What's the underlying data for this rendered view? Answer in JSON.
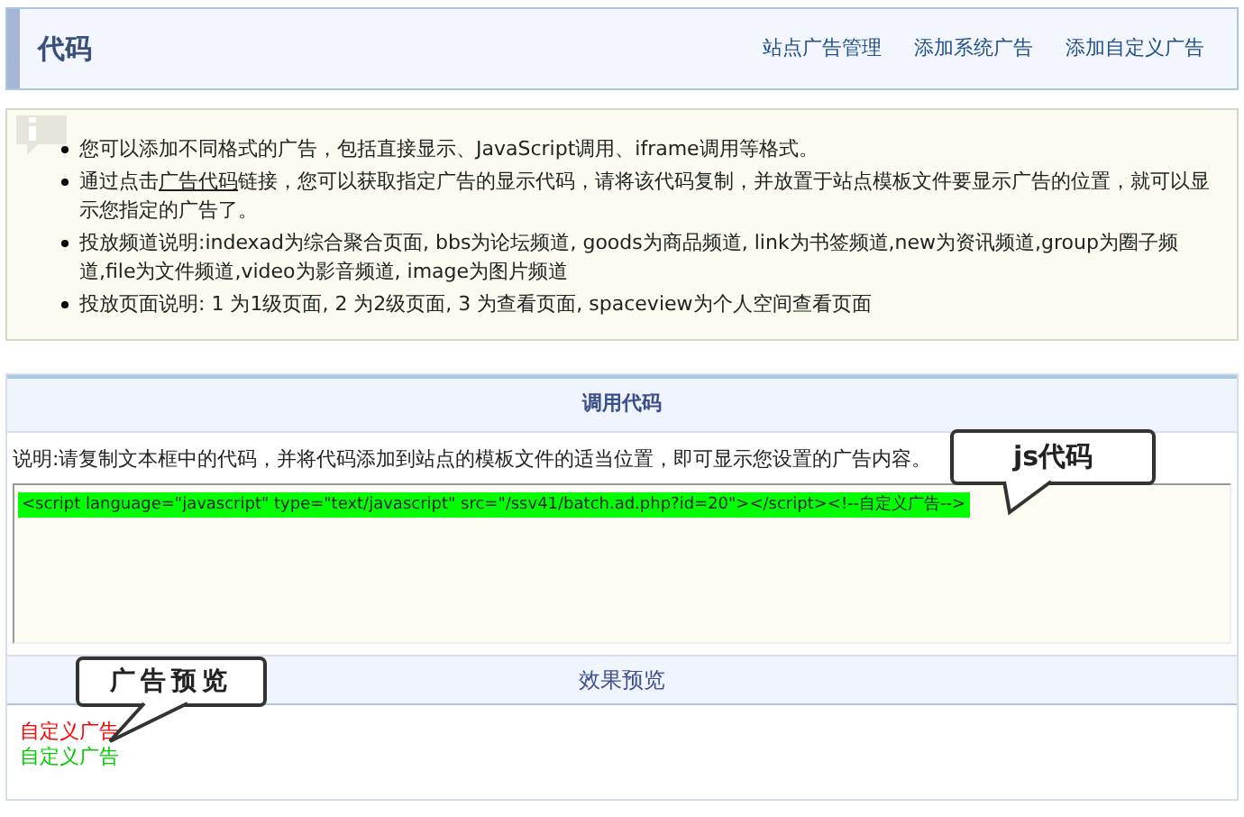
{
  "header": {
    "title": "代码",
    "links": [
      "站点广告管理",
      "添加系统广告",
      "添加自定义广告"
    ]
  },
  "tips": [
    {
      "text": "您可以添加不同格式的广告，包括直接显示、JavaScript调用、iframe调用等格式。"
    },
    {
      "before": "通过点击",
      "link": "广告代码",
      "after": "链接，您可以获取指定广告的显示代码，请将该代码复制，并放置于站点模板文件要显示广告的位置，就可以显示您指定的广告了。"
    },
    {
      "text": "投放频道说明:indexad为综合聚合页面, bbs为论坛频道, goods为商品频道, link为书签频道,new为资讯频道,group为圈子频道,file为文件频道,video为影音频道, image为图片频道"
    },
    {
      "text": "投放页面说明: 1 为1级页面, 2 为2级页面, 3 为查看页面, spaceview为个人空间查看页面"
    }
  ],
  "code_section": {
    "title": "调用代码",
    "description": "说明:请复制文本框中的代码，并将代码添加到站点的模板文件的适当位置，即可显示您设置的广告内容。",
    "code": "<script language=\"javascript\" type=\"text/javascript\" src=\"/ssv41/batch.ad.php?id=20\"></script><!--自定义广告-->"
  },
  "preview_section": {
    "title": "效果预览",
    "items": [
      {
        "text": "自定义广告",
        "color": "#ff0000"
      },
      {
        "text": "自定义广告",
        "color": "#00cc00"
      }
    ]
  },
  "callouts": [
    {
      "text": "js代码"
    },
    {
      "text": "广告预览"
    }
  ]
}
